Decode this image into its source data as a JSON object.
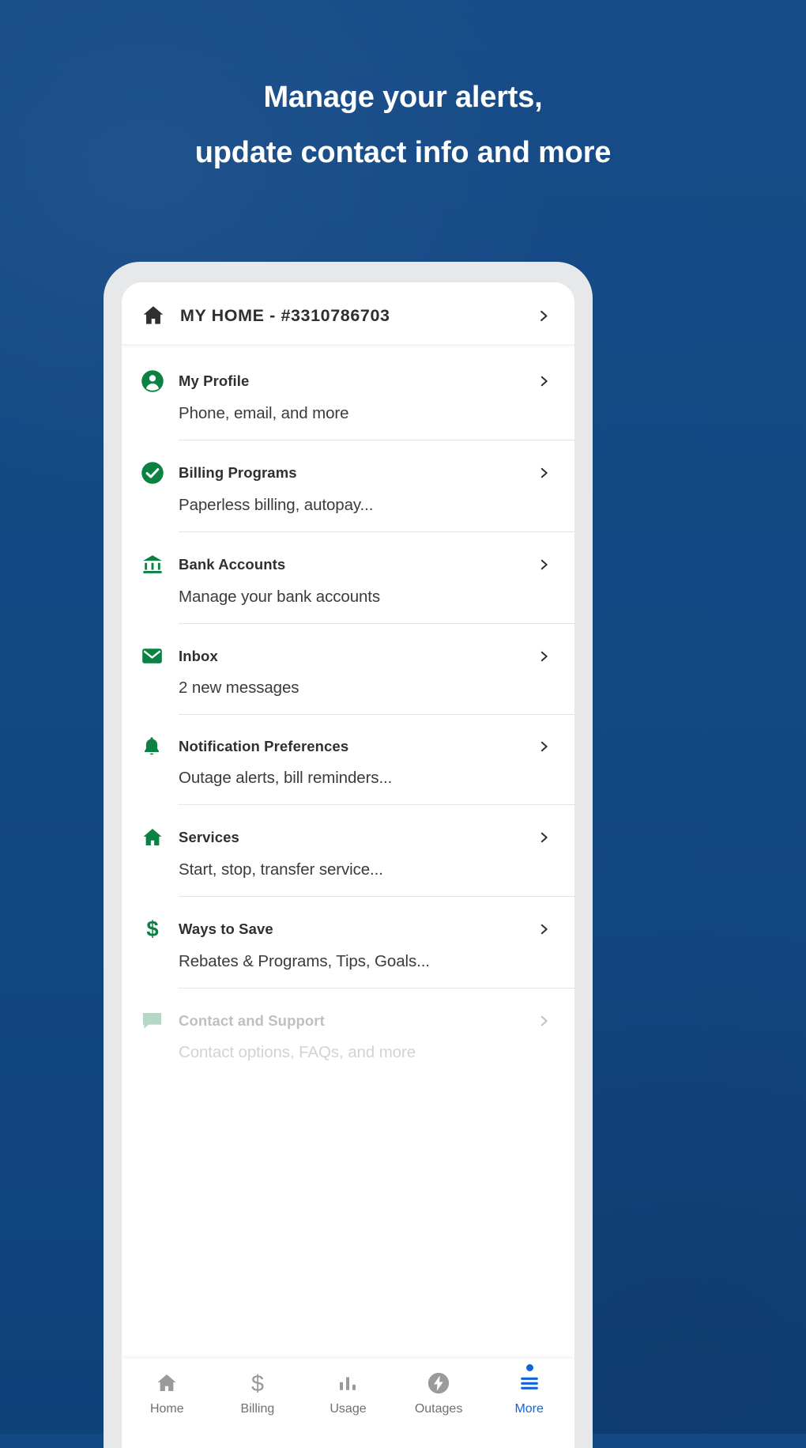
{
  "headline": {
    "line1": "Manage your alerts,",
    "line2": "update contact info and more"
  },
  "colors": {
    "background": "#154a86",
    "brand_green": "#0b8241",
    "accent_blue": "#1464d6",
    "text_dark": "#2f2f2f",
    "nav_inactive": "#9a9a9a"
  },
  "account": {
    "title": "MY HOME - #3310786703",
    "icon": "home-icon",
    "chevron": "chevron-right-icon"
  },
  "menu": {
    "items": [
      {
        "title": "My Profile",
        "subtitle": "Phone, email, and more",
        "icon": "person-circle-icon",
        "chevron": "chevron-right-icon"
      },
      {
        "title": "Billing Programs",
        "subtitle": "Paperless billing, autopay...",
        "icon": "check-circle-icon",
        "chevron": "chevron-right-icon"
      },
      {
        "title": "Bank Accounts",
        "subtitle": "Manage your bank accounts",
        "icon": "bank-icon",
        "chevron": "chevron-right-icon"
      },
      {
        "title": "Inbox",
        "subtitle": "2 new messages",
        "icon": "envelope-icon",
        "chevron": "chevron-right-icon"
      },
      {
        "title": "Notification Preferences",
        "subtitle": "Outage alerts, bill reminders...",
        "icon": "bell-icon",
        "chevron": "chevron-right-icon"
      },
      {
        "title": "Services",
        "subtitle": "Start, stop, transfer service...",
        "icon": "home-icon",
        "chevron": "chevron-right-icon"
      },
      {
        "title": "Ways to Save",
        "subtitle": "Rebates & Programs, Tips, Goals...",
        "icon": "dollar-icon",
        "chevron": "chevron-right-icon"
      },
      {
        "title": "Contact and Support",
        "subtitle": "Contact options, FAQs, and more",
        "icon": "chat-icon",
        "chevron": "chevron-right-icon"
      }
    ]
  },
  "bottom_nav": {
    "items": [
      {
        "label": "Home",
        "icon": "home-icon",
        "active": false,
        "badge": false
      },
      {
        "label": "Billing",
        "icon": "dollar-icon",
        "active": false,
        "badge": false
      },
      {
        "label": "Usage",
        "icon": "bar-chart-icon",
        "active": false,
        "badge": false
      },
      {
        "label": "Outages",
        "icon": "lightning-bolt-icon",
        "active": false,
        "badge": false
      },
      {
        "label": "More",
        "icon": "hamburger-menu-icon",
        "active": true,
        "badge": true
      }
    ]
  }
}
